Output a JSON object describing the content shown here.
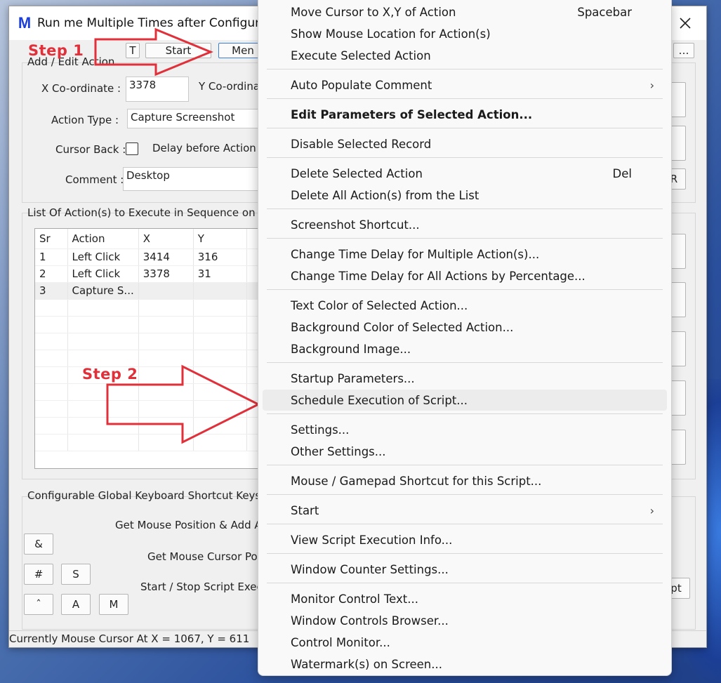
{
  "window": {
    "logo": "M",
    "title": "Run me Multiple Times after Configured",
    "close_glyph": "✕"
  },
  "toolbar": {
    "t_label": "T",
    "start_label": "Start",
    "menu_label": "Men"
  },
  "edit_group": {
    "legend": "Add / Edit Action",
    "x_label": "X Co-ordinate :",
    "x_value": "3378",
    "y_label": "Y Co-ordina",
    "action_type_label": "Action Type :",
    "action_type_value": "Capture Screenshot",
    "cursor_back_label": "Cursor Back :",
    "delay_label": "Delay before Action :",
    "comment_label": "Comment :",
    "comment_value": "Desktop"
  },
  "list_group": {
    "legend": "List Of Action(s) to Execute in Sequence on Sc",
    "columns": [
      "Sr",
      "Action",
      "X",
      "Y"
    ],
    "rows": [
      [
        "1",
        "Left Click",
        "3414",
        "316"
      ],
      [
        "2",
        "Left Click",
        "3378",
        "31"
      ],
      [
        "3",
        "Capture S...",
        "",
        ""
      ]
    ]
  },
  "shortcut_group": {
    "legend": "Configurable Global Keyboard Shortcut Keys fo",
    "get_mouse_add": "Get Mouse Position & Add A",
    "get_mouse_cursor": "Get Mouse Cursor Pos",
    "start_stop": "Start / Stop Script Execu",
    "keys": [
      "&",
      "#",
      "S",
      "ˆ",
      "A",
      "M"
    ]
  },
  "right_partial": {
    "r_label": "R",
    "pt_label": "pt"
  },
  "status_bar": {
    "text": "Currently Mouse Cursor At X = 1067, Y = 611"
  },
  "annotations": {
    "step1": "Step 1",
    "step2": "Step 2"
  },
  "menu": {
    "items": [
      {
        "label": "Move Cursor to X,Y of Action",
        "shortcut": "Spacebar"
      },
      {
        "label": "Show Mouse Location for Action(s)"
      },
      {
        "label": "Execute Selected Action"
      },
      {
        "label": "Auto Populate Comment",
        "submenu": "›"
      },
      {
        "label": "Edit Parameters of Selected Action..."
      },
      {
        "label": "Disable Selected Record"
      },
      {
        "label": "Delete Selected Action",
        "shortcut": "Del"
      },
      {
        "label": "Delete All Action(s) from the List"
      },
      {
        "label": "Screenshot Shortcut..."
      },
      {
        "label": "Change Time Delay for Multiple Action(s)..."
      },
      {
        "label": "Change Time Delay for All Actions by Percentage..."
      },
      {
        "label": "Text Color of Selected Action..."
      },
      {
        "label": "Background Color of Selected Action..."
      },
      {
        "label": "Background Image..."
      },
      {
        "label": "Startup Parameters..."
      },
      {
        "label": "Schedule Execution of Script..."
      },
      {
        "label": "Settings..."
      },
      {
        "label": "Other Settings..."
      },
      {
        "label": "Mouse / Gamepad Shortcut for this Script..."
      },
      {
        "label": "Start",
        "submenu": "›"
      },
      {
        "label": "View Script Execution Info..."
      },
      {
        "label": "Window Counter Settings..."
      },
      {
        "label": "Monitor Control Text..."
      },
      {
        "label": "Window Controls Browser..."
      },
      {
        "label": "Control Monitor..."
      },
      {
        "label": "Watermark(s) on Screen..."
      }
    ]
  },
  "colors": {
    "accent_red": "#e0303a",
    "logo_blue": "#1b3fd8"
  }
}
